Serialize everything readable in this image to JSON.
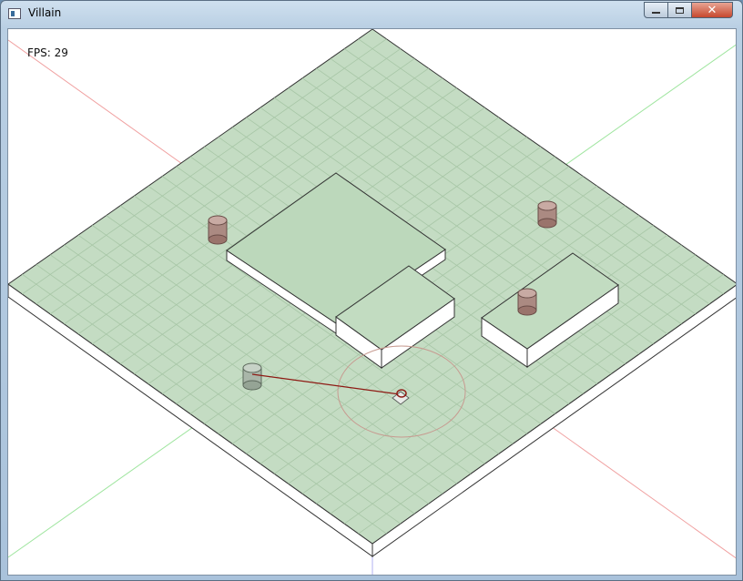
{
  "window": {
    "title": "Villain",
    "close_glyph": "✕"
  },
  "hud": {
    "fps_label": "FPS:",
    "fps_value": "29"
  },
  "colors": {
    "ground_fill": "#b7d6b6",
    "grid": "#9dbf9c",
    "axis_x": "#f0a0a0",
    "axis_z": "#9fe59f",
    "axis_y": "#a0a0f0",
    "enemy": "#a07a72",
    "player": "#8e3a34",
    "detection_ring": "#c79a90"
  },
  "icons": {
    "app": "window-app-icon",
    "minimize": "minimize-icon",
    "maximize": "maximize-icon",
    "close": "close-icon"
  }
}
